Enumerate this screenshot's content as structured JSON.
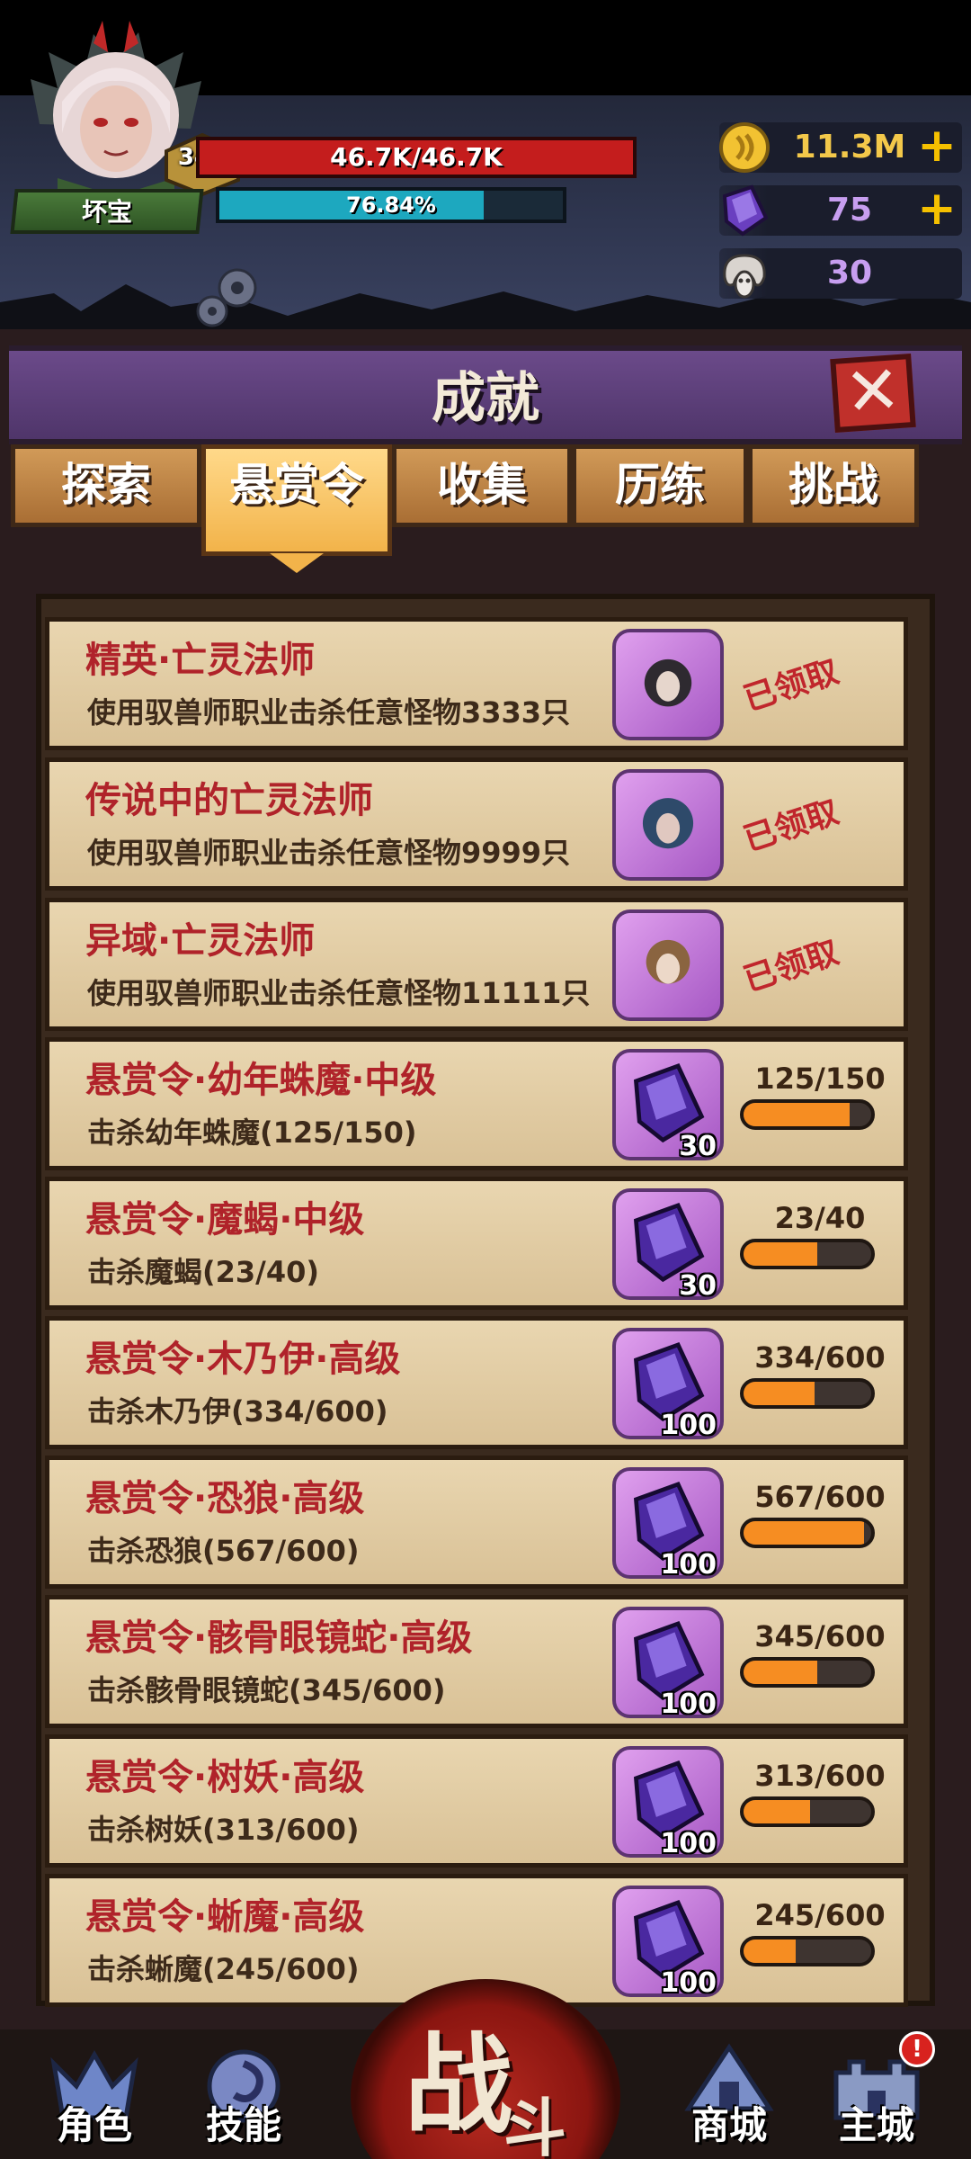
{
  "player": {
    "name": "坏宝",
    "level": "348",
    "hp_text": "46.7K/46.7K",
    "hp_fraction": 1.0,
    "xp_text": "76.84%",
    "xp_fraction": 0.7684
  },
  "currencies": [
    {
      "icon": "gold-coin-icon",
      "value": "11.3M",
      "has_plus": true,
      "color": "#f3c84a"
    },
    {
      "icon": "purple-crystal-icon",
      "value": "75",
      "has_plus": true,
      "color": "#c79ef0"
    },
    {
      "icon": "ram-skull-icon",
      "value": "30",
      "has_plus": false,
      "color": "#c79ef0"
    }
  ],
  "panel": {
    "title": "成就",
    "close_icon": "close-icon",
    "tabs": [
      {
        "label": "探索",
        "active": false
      },
      {
        "label": "悬赏令",
        "active": true
      },
      {
        "label": "收集",
        "active": false
      },
      {
        "label": "历练",
        "active": false
      },
      {
        "label": "挑战",
        "active": false
      }
    ]
  },
  "achievements": [
    {
      "title": "精英·亡灵法师",
      "desc": "使用驭兽师职业击杀任意怪物3333只",
      "reward": "portrait",
      "reward_qty": "",
      "status": "已领取"
    },
    {
      "title": "传说中的亡灵法师",
      "desc": "使用驭兽师职业击杀任意怪物9999只",
      "reward": "portrait",
      "reward_qty": "",
      "status": "已领取"
    },
    {
      "title": "异域·亡灵法师",
      "desc": "使用驭兽师职业击杀任意怪物11111只",
      "reward": "portrait",
      "reward_qty": "",
      "status": "已领取"
    },
    {
      "title": "悬赏令·幼年蛛魔·中级",
      "desc": "击杀幼年蛛魔(125/150)",
      "reward": "crystal",
      "reward_qty": "30",
      "progress": "125/150",
      "fraction": 0.833
    },
    {
      "title": "悬赏令·魔蝎·中级",
      "desc": "击杀魔蝎(23/40)",
      "reward": "crystal",
      "reward_qty": "30",
      "progress": "23/40",
      "fraction": 0.575
    },
    {
      "title": "悬赏令·木乃伊·高级",
      "desc": "击杀木乃伊(334/600)",
      "reward": "crystal",
      "reward_qty": "100",
      "progress": "334/600",
      "fraction": 0.557
    },
    {
      "title": "悬赏令·恐狼·高级",
      "desc": "击杀恐狼(567/600)",
      "reward": "crystal",
      "reward_qty": "100",
      "progress": "567/600",
      "fraction": 0.945
    },
    {
      "title": "悬赏令·骸骨眼镜蛇·高级",
      "desc": "击杀骸骨眼镜蛇(345/600)",
      "reward": "crystal",
      "reward_qty": "100",
      "progress": "345/600",
      "fraction": 0.575
    },
    {
      "title": "悬赏令·树妖·高级",
      "desc": "击杀树妖(313/600)",
      "reward": "crystal",
      "reward_qty": "100",
      "progress": "313/600",
      "fraction": 0.522
    },
    {
      "title": "悬赏令·蜥魔·高级",
      "desc": "击杀蜥魔(245/600)",
      "reward": "crystal",
      "reward_qty": "100",
      "progress": "245/600",
      "fraction": 0.408
    }
  ],
  "bottom_nav": {
    "items": [
      {
        "label": "角色",
        "icon": "helmet-icon"
      },
      {
        "label": "技能",
        "icon": "swirl-icon"
      },
      {
        "label": "商城",
        "icon": "tent-icon"
      },
      {
        "label": "主城",
        "icon": "castle-icon",
        "alert": "!"
      }
    ],
    "fight_a": "战",
    "fight_b": "斗"
  }
}
